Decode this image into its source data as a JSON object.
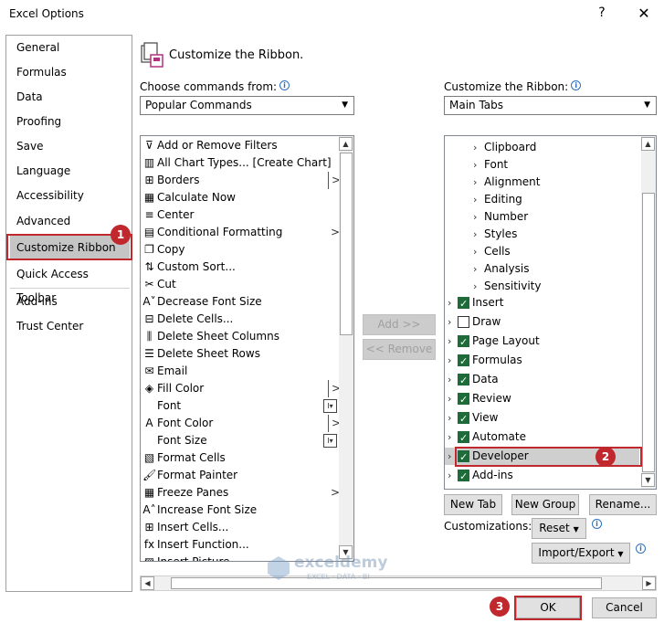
{
  "window": {
    "title": "Excel Options",
    "help_glyph": "?",
    "close_glyph": "✕"
  },
  "sidebar": {
    "items": [
      {
        "label": "General"
      },
      {
        "label": "Formulas"
      },
      {
        "label": "Data"
      },
      {
        "label": "Proofing"
      },
      {
        "label": "Save"
      },
      {
        "label": "Language"
      },
      {
        "label": "Accessibility"
      },
      {
        "label": "Advanced"
      },
      {
        "label": "Customize Ribbon",
        "selected": true
      },
      {
        "label": "Quick Access Toolbar"
      },
      {
        "label": "Add-ins"
      },
      {
        "label": "Trust Center"
      }
    ]
  },
  "annotations": {
    "step1": "1",
    "step2": "2",
    "step3": "3",
    "color": "#c0282e"
  },
  "header": {
    "title": "Customize the Ribbon."
  },
  "left": {
    "choose_label": "Choose commands from:",
    "choose_value": "Popular Commands",
    "commands": [
      {
        "label": "Add or Remove Filters",
        "icon": "filter-icon",
        "glyph": "⊽"
      },
      {
        "label": "All Chart Types... [Create Chart]",
        "icon": "chart-icon",
        "glyph": "▥"
      },
      {
        "label": "Borders",
        "icon": "borders-icon",
        "glyph": "⊞",
        "submenu": ">",
        "divider": true
      },
      {
        "label": "Calculate Now",
        "icon": "calculator-icon",
        "glyph": "▦"
      },
      {
        "label": "Center",
        "icon": "align-center-icon",
        "glyph": "≡"
      },
      {
        "label": "Conditional Formatting",
        "icon": "conditional-formatting-icon",
        "glyph": "▤",
        "submenu": ">"
      },
      {
        "label": "Copy",
        "icon": "copy-icon",
        "glyph": "❐"
      },
      {
        "label": "Custom Sort...",
        "icon": "sort-icon",
        "glyph": "⇅"
      },
      {
        "label": "Cut",
        "icon": "scissors-icon",
        "glyph": "✂"
      },
      {
        "label": "Decrease Font Size",
        "icon": "decrease-font-icon",
        "glyph": "A˅"
      },
      {
        "label": "Delete Cells...",
        "icon": "delete-cells-icon",
        "glyph": "⊟"
      },
      {
        "label": "Delete Sheet Columns",
        "icon": "delete-columns-icon",
        "glyph": "⫼"
      },
      {
        "label": "Delete Sheet Rows",
        "icon": "delete-rows-icon",
        "glyph": "☰"
      },
      {
        "label": "Email",
        "icon": "email-icon",
        "glyph": "✉"
      },
      {
        "label": "Fill Color",
        "icon": "fill-color-icon",
        "glyph": "◈",
        "submenu": ">",
        "divider": true
      },
      {
        "label": "Font",
        "icon": "",
        "glyph": "",
        "box": "I▾"
      },
      {
        "label": "Font Color",
        "icon": "font-color-icon",
        "glyph": "A",
        "submenu": ">",
        "divider": true
      },
      {
        "label": "Font Size",
        "icon": "",
        "glyph": "",
        "box": "I▾"
      },
      {
        "label": "Format Cells",
        "icon": "format-cells-icon",
        "glyph": "▧"
      },
      {
        "label": "Format Painter",
        "icon": "format-painter-icon",
        "glyph": "🖌"
      },
      {
        "label": "Freeze Panes",
        "icon": "freeze-panes-icon",
        "glyph": "▦",
        "submenu": ">"
      },
      {
        "label": "Increase Font Size",
        "icon": "increase-font-icon",
        "glyph": "A˄"
      },
      {
        "label": "Insert Cells...",
        "icon": "insert-cells-icon",
        "glyph": "⊞"
      },
      {
        "label": "Insert Function...",
        "icon": "function-icon",
        "glyph": "fx"
      },
      {
        "label": "Insert Picture",
        "icon": "picture-icon",
        "glyph": "▨"
      }
    ]
  },
  "middle": {
    "add_label": "Add >>",
    "remove_label": "<< Remove"
  },
  "right": {
    "customize_label": "Customize the Ribbon:",
    "customize_value": "Main Tabs",
    "groups": [
      "Clipboard",
      "Font",
      "Alignment",
      "Editing",
      "Number",
      "Styles",
      "Cells",
      "Analysis",
      "Sensitivity"
    ],
    "tabs": [
      {
        "label": "Insert",
        "checked": true
      },
      {
        "label": "Draw",
        "checked": false
      },
      {
        "label": "Page Layout",
        "checked": true
      },
      {
        "label": "Formulas",
        "checked": true
      },
      {
        "label": "Data",
        "checked": true
      },
      {
        "label": "Review",
        "checked": true
      },
      {
        "label": "View",
        "checked": true
      },
      {
        "label": "Automate",
        "checked": true
      },
      {
        "label": "Developer",
        "checked": true,
        "selected": true
      },
      {
        "label": "Add-ins",
        "checked": true
      }
    ],
    "new_tab_label": "New Tab",
    "new_group_label": "New Group",
    "rename_label": "Rename...",
    "customizations_label": "Customizations:",
    "reset_label": "Reset",
    "import_export_label": "Import/Export"
  },
  "footer": {
    "ok_label": "OK",
    "cancel_label": "Cancel"
  },
  "watermark": {
    "brand": "exceldemy",
    "tagline": "EXCEL · DATA · BI"
  }
}
